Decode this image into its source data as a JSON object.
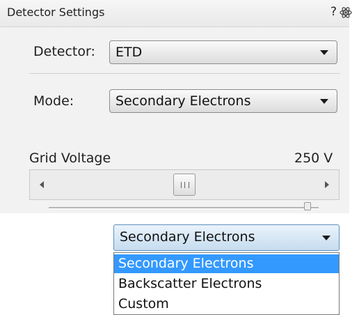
{
  "window": {
    "title": "Detector Settings",
    "help_label": "?",
    "pin_icon": "atom-icon"
  },
  "detector": {
    "label": "Detector:",
    "value": "ETD"
  },
  "mode": {
    "label": "Mode:",
    "value": "Secondary Electrons"
  },
  "grid_voltage": {
    "label": "Grid Voltage",
    "value": "250 V",
    "thumb_icon": "grip-icon"
  },
  "mode_dropdown": {
    "value": "Secondary Electrons",
    "options": [
      "Secondary Electrons",
      "Backscatter Electrons",
      "Custom"
    ],
    "selected_index": 0,
    "highlight_color": "#3399ff"
  }
}
